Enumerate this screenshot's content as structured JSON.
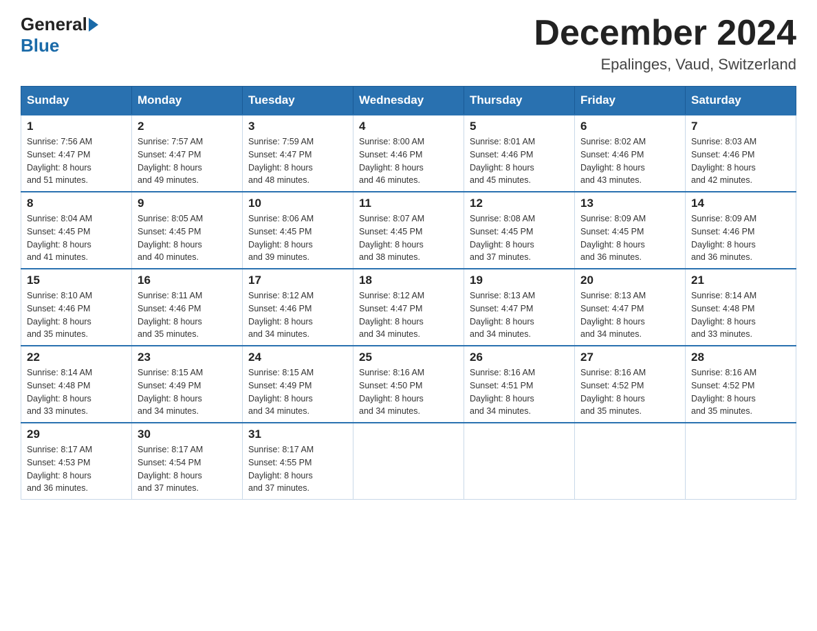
{
  "header": {
    "logo": {
      "general": "General",
      "blue": "Blue"
    },
    "title": "December 2024",
    "location": "Epalinges, Vaud, Switzerland"
  },
  "days_header": [
    "Sunday",
    "Monday",
    "Tuesday",
    "Wednesday",
    "Thursday",
    "Friday",
    "Saturday"
  ],
  "weeks": [
    [
      {
        "num": "1",
        "sunrise": "7:56 AM",
        "sunset": "4:47 PM",
        "daylight": "8 hours and 51 minutes."
      },
      {
        "num": "2",
        "sunrise": "7:57 AM",
        "sunset": "4:47 PM",
        "daylight": "8 hours and 49 minutes."
      },
      {
        "num": "3",
        "sunrise": "7:59 AM",
        "sunset": "4:47 PM",
        "daylight": "8 hours and 48 minutes."
      },
      {
        "num": "4",
        "sunrise": "8:00 AM",
        "sunset": "4:46 PM",
        "daylight": "8 hours and 46 minutes."
      },
      {
        "num": "5",
        "sunrise": "8:01 AM",
        "sunset": "4:46 PM",
        "daylight": "8 hours and 45 minutes."
      },
      {
        "num": "6",
        "sunrise": "8:02 AM",
        "sunset": "4:46 PM",
        "daylight": "8 hours and 43 minutes."
      },
      {
        "num": "7",
        "sunrise": "8:03 AM",
        "sunset": "4:46 PM",
        "daylight": "8 hours and 42 minutes."
      }
    ],
    [
      {
        "num": "8",
        "sunrise": "8:04 AM",
        "sunset": "4:45 PM",
        "daylight": "8 hours and 41 minutes."
      },
      {
        "num": "9",
        "sunrise": "8:05 AM",
        "sunset": "4:45 PM",
        "daylight": "8 hours and 40 minutes."
      },
      {
        "num": "10",
        "sunrise": "8:06 AM",
        "sunset": "4:45 PM",
        "daylight": "8 hours and 39 minutes."
      },
      {
        "num": "11",
        "sunrise": "8:07 AM",
        "sunset": "4:45 PM",
        "daylight": "8 hours and 38 minutes."
      },
      {
        "num": "12",
        "sunrise": "8:08 AM",
        "sunset": "4:45 PM",
        "daylight": "8 hours and 37 minutes."
      },
      {
        "num": "13",
        "sunrise": "8:09 AM",
        "sunset": "4:45 PM",
        "daylight": "8 hours and 36 minutes."
      },
      {
        "num": "14",
        "sunrise": "8:09 AM",
        "sunset": "4:46 PM",
        "daylight": "8 hours and 36 minutes."
      }
    ],
    [
      {
        "num": "15",
        "sunrise": "8:10 AM",
        "sunset": "4:46 PM",
        "daylight": "8 hours and 35 minutes."
      },
      {
        "num": "16",
        "sunrise": "8:11 AM",
        "sunset": "4:46 PM",
        "daylight": "8 hours and 35 minutes."
      },
      {
        "num": "17",
        "sunrise": "8:12 AM",
        "sunset": "4:46 PM",
        "daylight": "8 hours and 34 minutes."
      },
      {
        "num": "18",
        "sunrise": "8:12 AM",
        "sunset": "4:47 PM",
        "daylight": "8 hours and 34 minutes."
      },
      {
        "num": "19",
        "sunrise": "8:13 AM",
        "sunset": "4:47 PM",
        "daylight": "8 hours and 34 minutes."
      },
      {
        "num": "20",
        "sunrise": "8:13 AM",
        "sunset": "4:47 PM",
        "daylight": "8 hours and 34 minutes."
      },
      {
        "num": "21",
        "sunrise": "8:14 AM",
        "sunset": "4:48 PM",
        "daylight": "8 hours and 33 minutes."
      }
    ],
    [
      {
        "num": "22",
        "sunrise": "8:14 AM",
        "sunset": "4:48 PM",
        "daylight": "8 hours and 33 minutes."
      },
      {
        "num": "23",
        "sunrise": "8:15 AM",
        "sunset": "4:49 PM",
        "daylight": "8 hours and 34 minutes."
      },
      {
        "num": "24",
        "sunrise": "8:15 AM",
        "sunset": "4:49 PM",
        "daylight": "8 hours and 34 minutes."
      },
      {
        "num": "25",
        "sunrise": "8:16 AM",
        "sunset": "4:50 PM",
        "daylight": "8 hours and 34 minutes."
      },
      {
        "num": "26",
        "sunrise": "8:16 AM",
        "sunset": "4:51 PM",
        "daylight": "8 hours and 34 minutes."
      },
      {
        "num": "27",
        "sunrise": "8:16 AM",
        "sunset": "4:52 PM",
        "daylight": "8 hours and 35 minutes."
      },
      {
        "num": "28",
        "sunrise": "8:16 AM",
        "sunset": "4:52 PM",
        "daylight": "8 hours and 35 minutes."
      }
    ],
    [
      {
        "num": "29",
        "sunrise": "8:17 AM",
        "sunset": "4:53 PM",
        "daylight": "8 hours and 36 minutes."
      },
      {
        "num": "30",
        "sunrise": "8:17 AM",
        "sunset": "4:54 PM",
        "daylight": "8 hours and 37 minutes."
      },
      {
        "num": "31",
        "sunrise": "8:17 AM",
        "sunset": "4:55 PM",
        "daylight": "8 hours and 37 minutes."
      },
      null,
      null,
      null,
      null
    ]
  ],
  "labels": {
    "sunrise": "Sunrise:",
    "sunset": "Sunset:",
    "daylight": "Daylight:"
  }
}
